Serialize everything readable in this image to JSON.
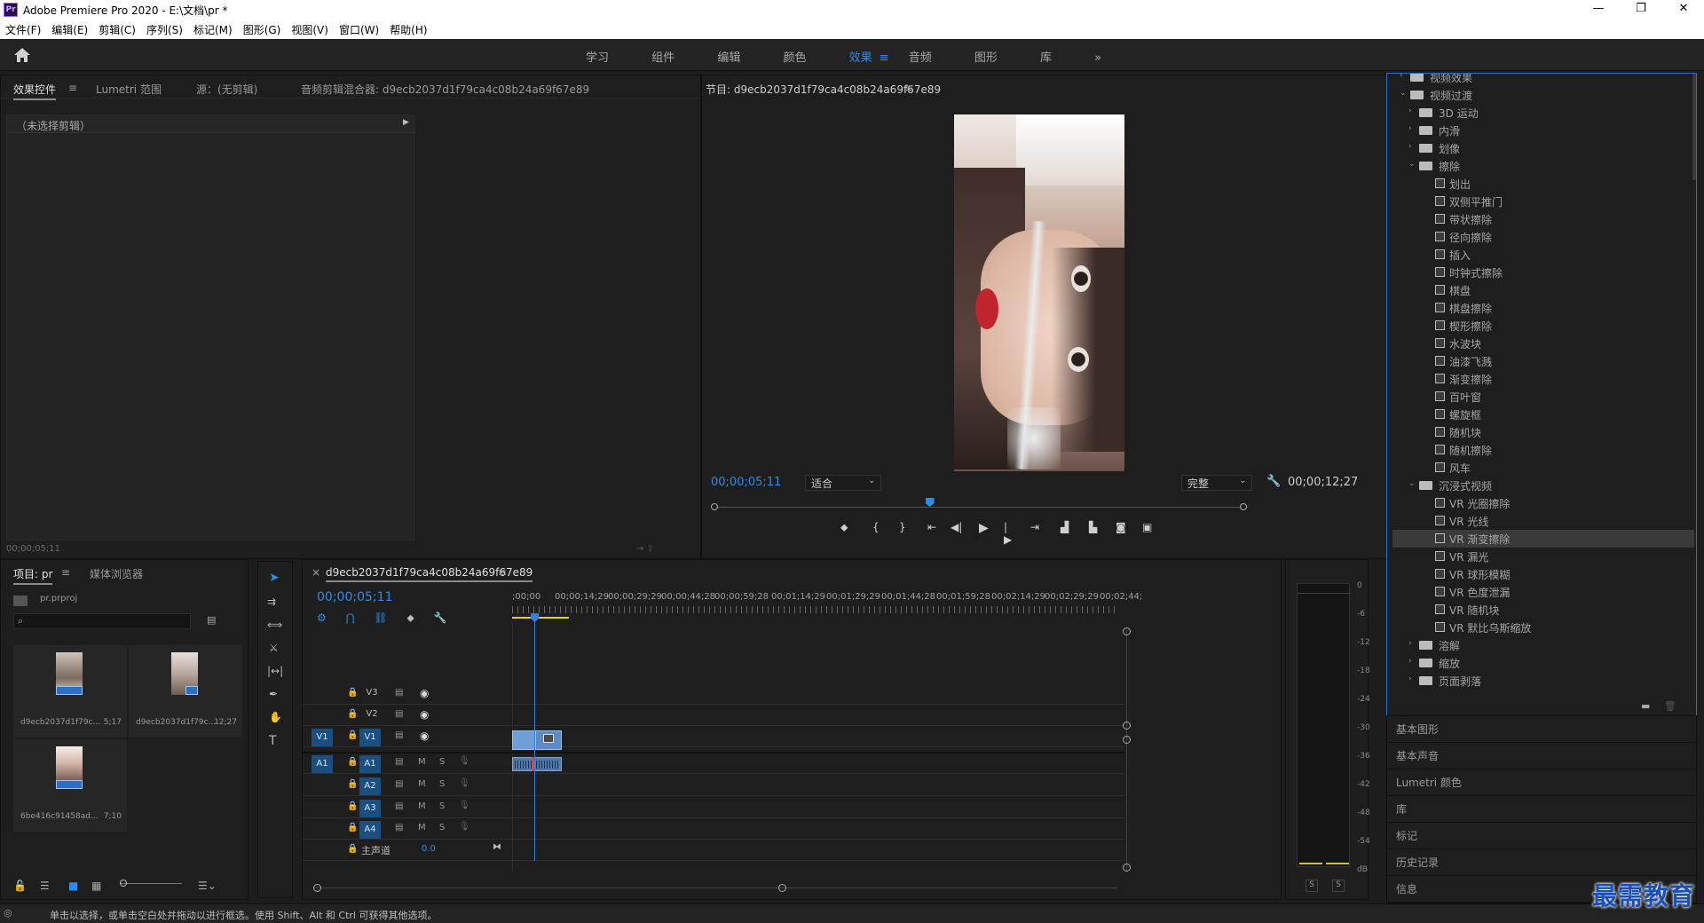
{
  "window": {
    "app_icon": "Pr",
    "title": "Adobe Premiere Pro 2020 - E:\\文档\\pr *",
    "controls": [
      "—",
      "❐",
      "✕"
    ]
  },
  "menu": [
    "文件(F)",
    "编辑(E)",
    "剪辑(C)",
    "序列(S)",
    "标记(M)",
    "图形(G)",
    "视图(V)",
    "窗口(W)",
    "帮助(H)"
  ],
  "workspaces": {
    "tabs": [
      "学习",
      "组件",
      "编辑",
      "颜色",
      "效果",
      "音频",
      "图形",
      "库"
    ],
    "active": "效果",
    "overflow": "»"
  },
  "source_panel": {
    "tabs": [
      "效果控件",
      "Lumetri 范围",
      "源：(无剪辑)",
      "音频剪辑混合器: d9ecb2037d1f79ca4c08b24a69f67e89"
    ],
    "no_clip": "（未选择剪辑）",
    "timecode": "00;00;05;11"
  },
  "program": {
    "title": "节目: d9ecb2037d1f79ca4c08b24a69f67e89",
    "timecode": "00;00;05;11",
    "fit": "适合",
    "quality": "完整",
    "duration": "00;00;12;27",
    "playhead_fraction": 0.4
  },
  "project": {
    "tabs": [
      "项目: pr",
      "媒体浏览器"
    ],
    "file": "pr.prproj",
    "items": [
      {
        "name": "d9ecb2037d1f79c...",
        "dur": "5;17"
      },
      {
        "name": "d9ecb2037d1f79c...",
        "dur": "12;27"
      },
      {
        "name": "6be416c91458ad...",
        "dur": "7;10"
      }
    ]
  },
  "timeline": {
    "tab": "d9ecb2037d1f79ca4c08b24a69f67e89",
    "timecode": "00;00;05;11",
    "ruler": [
      ";00;00",
      "00;00;14;29",
      "00;00;29;29",
      "00;00;44;28",
      "00;00;59;28",
      "00;01;14;29",
      "00;01;29;29",
      "00;01;44;28",
      "00;01;59;28",
      "00;02;14;29",
      "00;02;29;29",
      "00;02;44;"
    ],
    "video_tracks": [
      "V3",
      "V2",
      "V1"
    ],
    "audio_tracks": [
      "A1",
      "A2",
      "A3",
      "A4"
    ],
    "source_v": "V1",
    "source_a": "A1",
    "master": "主声道",
    "master_val": "0.0",
    "m": "M",
    "s": "S"
  },
  "effects": {
    "items": [
      {
        "label": "视频效果",
        "level": 0,
        "kind": "folder",
        "open": false
      },
      {
        "label": "视频过渡",
        "level": 0,
        "kind": "folder",
        "open": true
      },
      {
        "label": "3D 运动",
        "level": 1,
        "kind": "folder",
        "open": false
      },
      {
        "label": "内滑",
        "level": 1,
        "kind": "folder",
        "open": false
      },
      {
        "label": "划像",
        "level": 1,
        "kind": "folder",
        "open": false
      },
      {
        "label": "擦除",
        "level": 1,
        "kind": "folder",
        "open": true
      },
      {
        "label": "划出",
        "level": 2,
        "kind": "fx"
      },
      {
        "label": "双侧平推门",
        "level": 2,
        "kind": "fx"
      },
      {
        "label": "带状擦除",
        "level": 2,
        "kind": "fx"
      },
      {
        "label": "径向擦除",
        "level": 2,
        "kind": "fx"
      },
      {
        "label": "插入",
        "level": 2,
        "kind": "fx"
      },
      {
        "label": "时钟式擦除",
        "level": 2,
        "kind": "fx"
      },
      {
        "label": "棋盘",
        "level": 2,
        "kind": "fx"
      },
      {
        "label": "棋盘擦除",
        "level": 2,
        "kind": "fx"
      },
      {
        "label": "楔形擦除",
        "level": 2,
        "kind": "fx"
      },
      {
        "label": "水波块",
        "level": 2,
        "kind": "fx"
      },
      {
        "label": "油漆飞溅",
        "level": 2,
        "kind": "fx"
      },
      {
        "label": "渐变擦除",
        "level": 2,
        "kind": "fx"
      },
      {
        "label": "百叶窗",
        "level": 2,
        "kind": "fx"
      },
      {
        "label": "螺旋框",
        "level": 2,
        "kind": "fx"
      },
      {
        "label": "随机块",
        "level": 2,
        "kind": "fx"
      },
      {
        "label": "随机擦除",
        "level": 2,
        "kind": "fx"
      },
      {
        "label": "风车",
        "level": 2,
        "kind": "fx"
      },
      {
        "label": "沉浸式视频",
        "level": 1,
        "kind": "folder",
        "open": true
      },
      {
        "label": "VR 光圈擦除",
        "level": 2,
        "kind": "fx"
      },
      {
        "label": "VR 光线",
        "level": 2,
        "kind": "fx"
      },
      {
        "label": "VR 渐变擦除",
        "level": 2,
        "kind": "fx",
        "selected": true
      },
      {
        "label": "VR 漏光",
        "level": 2,
        "kind": "fx"
      },
      {
        "label": "VR 球形模糊",
        "level": 2,
        "kind": "fx"
      },
      {
        "label": "VR 色度泄漏",
        "level": 2,
        "kind": "fx"
      },
      {
        "label": "VR 随机块",
        "level": 2,
        "kind": "fx"
      },
      {
        "label": "VR 默比乌斯缩放",
        "level": 2,
        "kind": "fx"
      },
      {
        "label": "溶解",
        "level": 1,
        "kind": "folder",
        "open": false
      },
      {
        "label": "缩放",
        "level": 1,
        "kind": "folder",
        "open": false
      },
      {
        "label": "页面剥落",
        "level": 1,
        "kind": "folder",
        "open": false
      }
    ]
  },
  "side_panels": [
    "基本图形",
    "基本声音",
    "Lumetri 颜色",
    "库",
    "标记",
    "历史记录",
    "信息"
  ],
  "meter": {
    "ticks": [
      "0",
      "-6",
      "-12",
      "-18",
      "-24",
      "-30",
      "-36",
      "-42",
      "-48",
      "-54",
      "dB"
    ],
    "solo": [
      "S",
      "S"
    ]
  },
  "status": "单击以选择，或单击空白处并拖动以进行框选。使用 Shift、Alt 和 Ctrl 可获得其他选项。",
  "watermark": "最需教育",
  "colors": {
    "accent": "#2d8ceb",
    "playhead": "#3b7fd9",
    "clip": "#6f9fd6",
    "track_on": "#1a4f80"
  }
}
